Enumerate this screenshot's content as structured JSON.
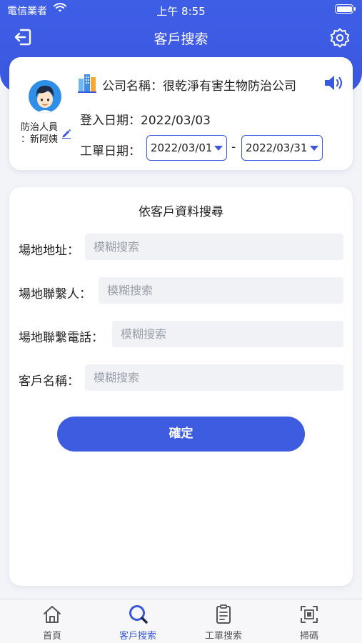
{
  "status_bar": {
    "carrier": "電信業者",
    "time": "上午 8:55"
  },
  "nav": {
    "title": "客戶搜索",
    "logout_icon": "logout-icon",
    "settings_icon": "gear-icon"
  },
  "profile": {
    "staff_label_line1": "防治人員",
    "staff_label_line2": "：新阿姨",
    "company_label": "公司名稱：很乾淨有害生物防治公司",
    "login_date_label": "登入日期：2022/03/03",
    "work_date_label": "工單日期：",
    "work_date_from": "2022/03/01",
    "work_date_separator": "-",
    "work_date_to": "2022/03/31"
  },
  "search": {
    "title": "依客戶資料搜尋",
    "fields": [
      {
        "label": "場地地址：",
        "placeholder": "模糊搜索"
      },
      {
        "label": "場地聯繫人：",
        "placeholder": "模糊搜索"
      },
      {
        "label": "場地聯繫電話：",
        "placeholder": "模糊搜索"
      },
      {
        "label": "客戶名稱：",
        "placeholder": "模糊搜索"
      }
    ],
    "confirm_label": "確定"
  },
  "tabs": [
    {
      "label": "首頁",
      "icon": "home-icon",
      "active": false
    },
    {
      "label": "客戶搜索",
      "icon": "search-icon",
      "active": true
    },
    {
      "label": "工單搜索",
      "icon": "clipboard-icon",
      "active": false
    },
    {
      "label": "掃碼",
      "icon": "scan-icon",
      "active": false
    }
  ],
  "colors": {
    "primary": "#3a57e0",
    "background": "#f3f4f8",
    "input_bg": "#f1f2f6"
  }
}
